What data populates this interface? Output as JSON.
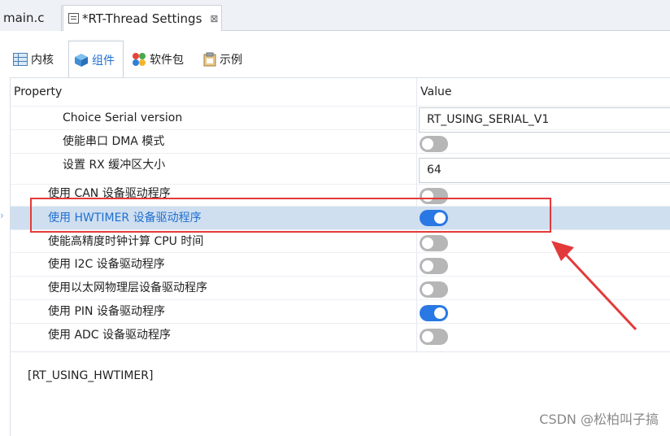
{
  "editor_tabs": [
    {
      "label": "main.c"
    },
    {
      "label": "*RT-Thread Settings",
      "close": "⊠"
    }
  ],
  "page_tabs": [
    {
      "label": "内核",
      "icon": "table-icon"
    },
    {
      "label": "组件",
      "icon": "cube-icon",
      "active": true
    },
    {
      "label": "软件包",
      "icon": "package-icon"
    },
    {
      "label": "示例",
      "icon": "clipboard-icon"
    }
  ],
  "table": {
    "header_property": "Property",
    "header_value": "Value",
    "rows": [
      {
        "label": "Choice Serial version",
        "level": 2,
        "type": "text",
        "value": "RT_USING_SERIAL_V1"
      },
      {
        "label": "使能串口 DMA 模式",
        "level": 2,
        "type": "toggle",
        "on": false
      },
      {
        "label": "设置 RX 缓冲区大小",
        "level": 2,
        "type": "text",
        "value": "64"
      },
      {
        "label": "使用 CAN 设备驱动程序",
        "level": 1,
        "type": "toggle",
        "on": false
      },
      {
        "label": "使用 HWTIMER 设备驱动程序",
        "level": 1,
        "type": "toggle",
        "on": true,
        "selected": true
      },
      {
        "label": "使能高精度时钟计算 CPU 时间",
        "level": 1,
        "type": "toggle",
        "on": false
      },
      {
        "label": "使用 I2C 设备驱动程序",
        "level": 1,
        "type": "toggle",
        "on": false
      },
      {
        "label": "使用以太网物理层设备驱动程序",
        "level": 1,
        "type": "toggle",
        "on": false
      },
      {
        "label": "使用 PIN 设备驱动程序",
        "level": 1,
        "type": "toggle",
        "on": true
      },
      {
        "label": "使用 ADC 设备驱动程序",
        "level": 1,
        "type": "toggle",
        "on": false
      }
    ]
  },
  "macro_name": "[RT_USING_HWTIMER]",
  "watermark": "CSDN @松柏叫子搞",
  "colors": {
    "accent": "#2a78e4",
    "selection": "#cfdff0",
    "annotation": "#e23a3a"
  }
}
